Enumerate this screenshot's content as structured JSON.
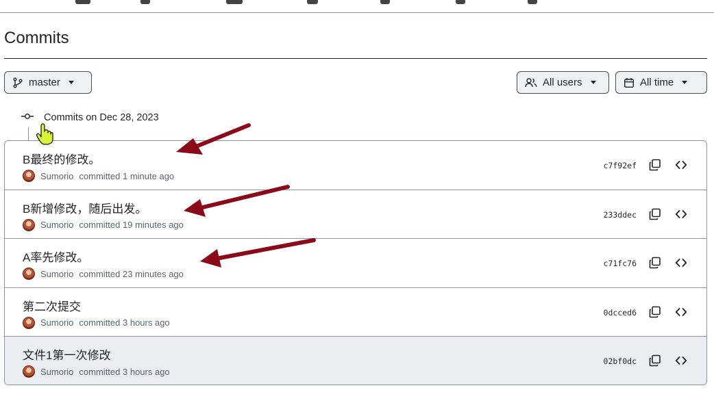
{
  "page": {
    "title": "Commits"
  },
  "toolbar": {
    "branch_label": "master",
    "users_label": "All users",
    "time_label": "All time"
  },
  "group": {
    "header": "Commits on Dec 28, 2023"
  },
  "commits": [
    {
      "message": "B最终的修改。",
      "author": "Sumorio",
      "committed_text": "committed 1 minute ago",
      "sha": "c7f92ef"
    },
    {
      "message": "B新增修改，随后出发。",
      "author": "Sumorio",
      "committed_text": "committed 19 minutes ago",
      "sha": "233ddec"
    },
    {
      "message": "A率先修改。",
      "author": "Sumorio",
      "committed_text": "committed 23 minutes ago",
      "sha": "c71fc76"
    },
    {
      "message": "第二次提交",
      "author": "Sumorio",
      "committed_text": "committed 3 hours ago",
      "sha": "0dcced6"
    },
    {
      "message": "文件1第一次修改",
      "author": "Sumorio",
      "committed_text": "committed 3 hours ago",
      "sha": "02bf0dc"
    }
  ],
  "colors": {
    "annotation_arrow": "#8b0a1a",
    "cursor": "#d9f23a",
    "row_highlight": "#eaedf2"
  }
}
